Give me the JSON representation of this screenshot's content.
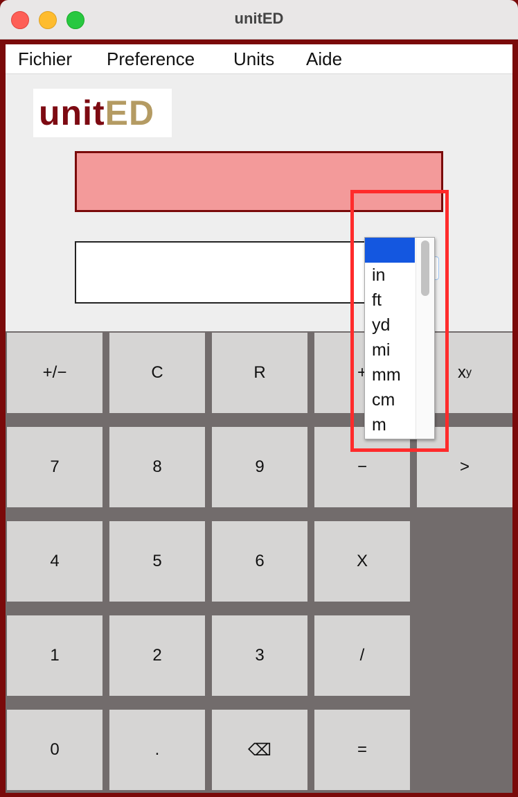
{
  "window": {
    "title": "unitED"
  },
  "menu": [
    {
      "label": "Fichier"
    },
    {
      "label": "Preference"
    },
    {
      "label": "Units"
    },
    {
      "label": "Aide"
    }
  ],
  "logo": {
    "part1": "unit",
    "part2": "ED"
  },
  "unit_select": {
    "selected": "",
    "options": [
      "",
      "in",
      "ft",
      "yd",
      "mi",
      "mm",
      "cm",
      "m"
    ]
  },
  "keypad": {
    "row1": [
      "+/−",
      "C",
      "R",
      "+",
      "x",
      "y"
    ],
    "row2": [
      "7",
      "8",
      "9",
      "−",
      ">"
    ],
    "row3": [
      "4",
      "5",
      "6",
      "X"
    ],
    "row4": [
      "1",
      "2",
      "3",
      "/"
    ],
    "row5": [
      "0",
      ".",
      "⌫",
      "="
    ]
  },
  "colors": {
    "frame": "#7a0a0a",
    "display": "#f39a9a",
    "keypad_bg": "#726c6c",
    "key": "#d6d5d4",
    "selection": "#1457e0",
    "highlight": "#ff2b2b"
  }
}
